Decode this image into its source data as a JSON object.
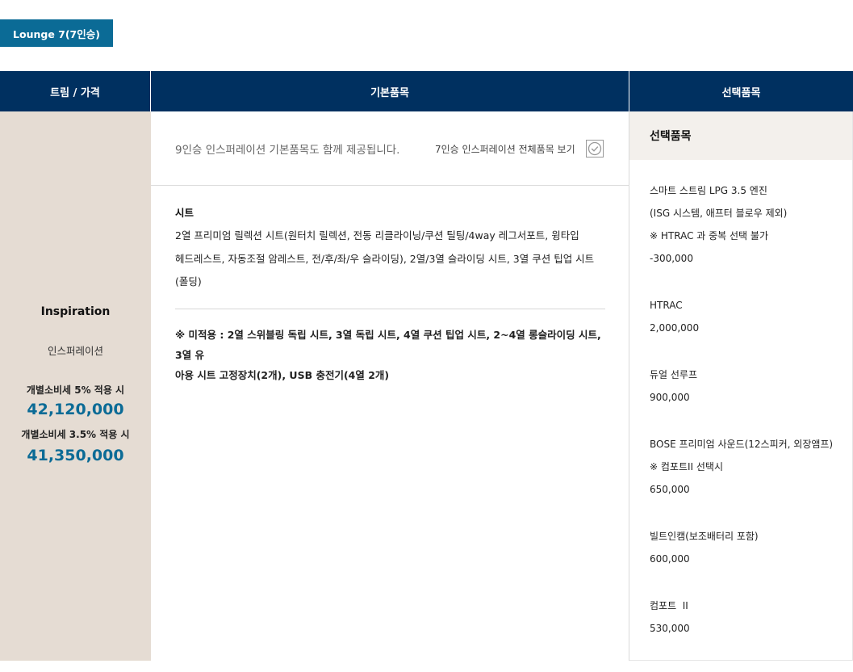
{
  "tab": {
    "label": "Lounge 7(7인승)"
  },
  "header": {
    "col_trim": "트림 / 가격",
    "col_base": "기본품목",
    "col_option": "선택품목"
  },
  "trim": {
    "name": "Inspiration",
    "name_ko": "인스퍼레이션",
    "tax5_label": "개별소비세 5% 적용 시",
    "tax5_price": "42,120,000",
    "tax35_label": "개별소비세 3.5% 적용 시",
    "tax35_price": "41,350,000"
  },
  "base": {
    "notice": "9인승 인스퍼레이션 기본품목도 함께 제공됩니다.",
    "view_all_link": "7인승 인스퍼레이션 전체품목 보기",
    "section_title": "시트",
    "section_lines": [
      "2열 프리미엄 릴렉션 시트(원터치 릴렉션, 전동 리클라이닝/쿠션 틸팅/4way 레그서포트, 윙타입",
      "헤드레스트, 자동조절 암레스트, 전/후/좌/우 슬라이딩), 2열/3열 슬라이딩 시트, 3열 쿠션 팁업 시트",
      "(폴딩)"
    ],
    "note_lines": [
      "※ 미적용 : 2열 스위블링 독립 시트, 3열 독립 시트, 4열 쿠션 팁업 시트, 2~4열 롱슬라이딩 시트, 3열 유",
      "아용 시트 고정장치(2개), USB 충전기(4열 2개)"
    ]
  },
  "options": {
    "title": "선택품목",
    "items": [
      {
        "lines": [
          "스마트 스트림 LPG 3.5 엔진",
          "(ISG 시스템, 애프터 블로우 제외)",
          "※ HTRAC 과 중복 선택 불가"
        ],
        "price": "-300,000"
      },
      {
        "lines": [
          "HTRAC"
        ],
        "price": "2,000,000"
      },
      {
        "lines": [
          "듀얼 선루프"
        ],
        "price": "900,000"
      },
      {
        "lines": [
          "BOSE 프리미엄 사운드(12스피커, 외장앰프)",
          "※ 컴포트II 선택시"
        ],
        "price": "650,000"
      },
      {
        "lines": [
          "빌트인캠(보조배터리 포함)"
        ],
        "price": "600,000"
      },
      {
        "lines": [
          "컴포트  II"
        ],
        "price": "530,000"
      }
    ]
  }
}
